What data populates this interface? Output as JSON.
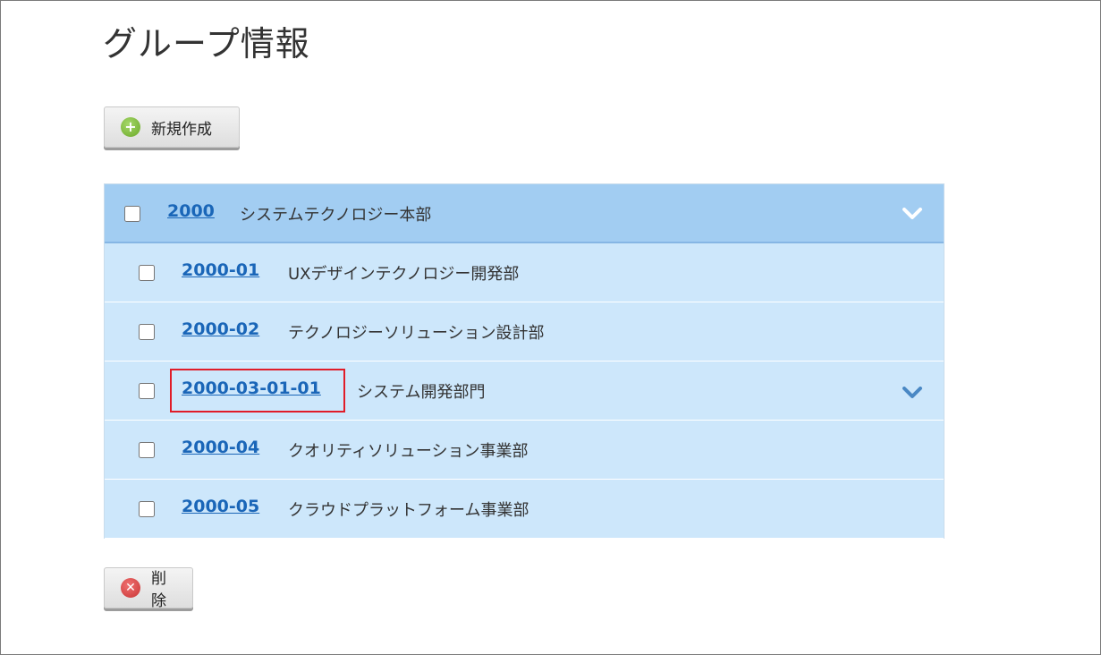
{
  "page": {
    "title": "グループ情報"
  },
  "toolbar": {
    "new_label": "新規作成",
    "delete_label": "削除"
  },
  "groups": {
    "parent": {
      "code": "2000",
      "name": "システムテクノロジー本部",
      "expanded": true
    },
    "children": [
      {
        "code": "2000-01",
        "name": "UXデザインテクノロジー開発部"
      },
      {
        "code": "2000-02",
        "name": "テクノロジーソリューション設計部"
      },
      {
        "code": "2000-03-01-01",
        "name": "システム開発部門",
        "has_children": true,
        "highlighted": true
      },
      {
        "code": "2000-04",
        "name": "クオリティソリューション事業部"
      },
      {
        "code": "2000-05",
        "name": "クラウドプラットフォーム事業部"
      }
    ]
  },
  "colors": {
    "parent_row_bg": "#a2cdf2",
    "child_row_bg": "#cde7fb",
    "link": "#1a66b8",
    "highlight_border": "#e01c28"
  }
}
